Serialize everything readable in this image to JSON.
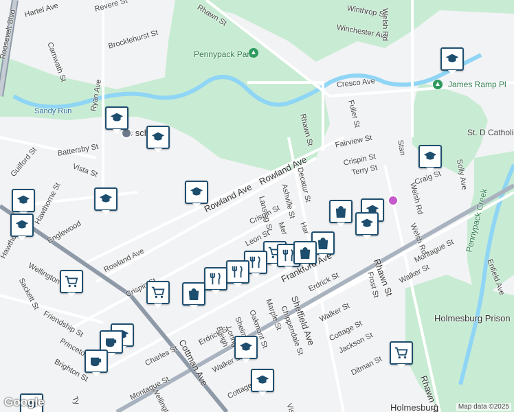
{
  "map": {
    "streets": [
      "Hartel Ave",
      "Revere St",
      "Carnwath St",
      "Brocklehurst St",
      "Rhawn St",
      "Winthrop St",
      "Winchester Ave",
      "Welsh Rd",
      "Pennypack Park",
      "Roosevelt Blvd",
      "Sandy Run",
      "Ryan Ave",
      "Cresco Ave",
      "Fuller St",
      "James Ramp Pl",
      "Battersby St",
      "Vista St",
      "Rowland Ave",
      "Lansing St",
      "Ashville St",
      "Decatur St",
      "Fairview St",
      "Crispin St",
      "Terry St",
      "Craig St",
      "Solly Ave",
      "Guilford St",
      "Hawthorne St",
      "Englewood",
      "Wellington",
      "Sackett St",
      "Friendship St",
      "Princeton",
      "Brighton St",
      "Frankford Ave",
      "Sheffield Ave",
      "Marple St",
      "Chippendale St",
      "Oakmont St",
      "Shelmire Ave",
      "Loring St",
      "Bleigh",
      "Erdrick St",
      "Walker St",
      "Cottage St",
      "Cottman Ave",
      "Charles St",
      "Montague St",
      "Jackson St",
      "Ditman St",
      "Frost St",
      "Holmesburg Prison",
      "Pennypack Creek",
      "Enfield Ave",
      "St. D Catholic",
      "Vista St",
      "Leon St",
      "Mer",
      "Har",
      "Stan",
      "Ty"
    ],
    "school_label": "Ac school",
    "attribution": "Map data ©2025",
    "logo": "Google",
    "bottom_label": "Holmesburg"
  }
}
